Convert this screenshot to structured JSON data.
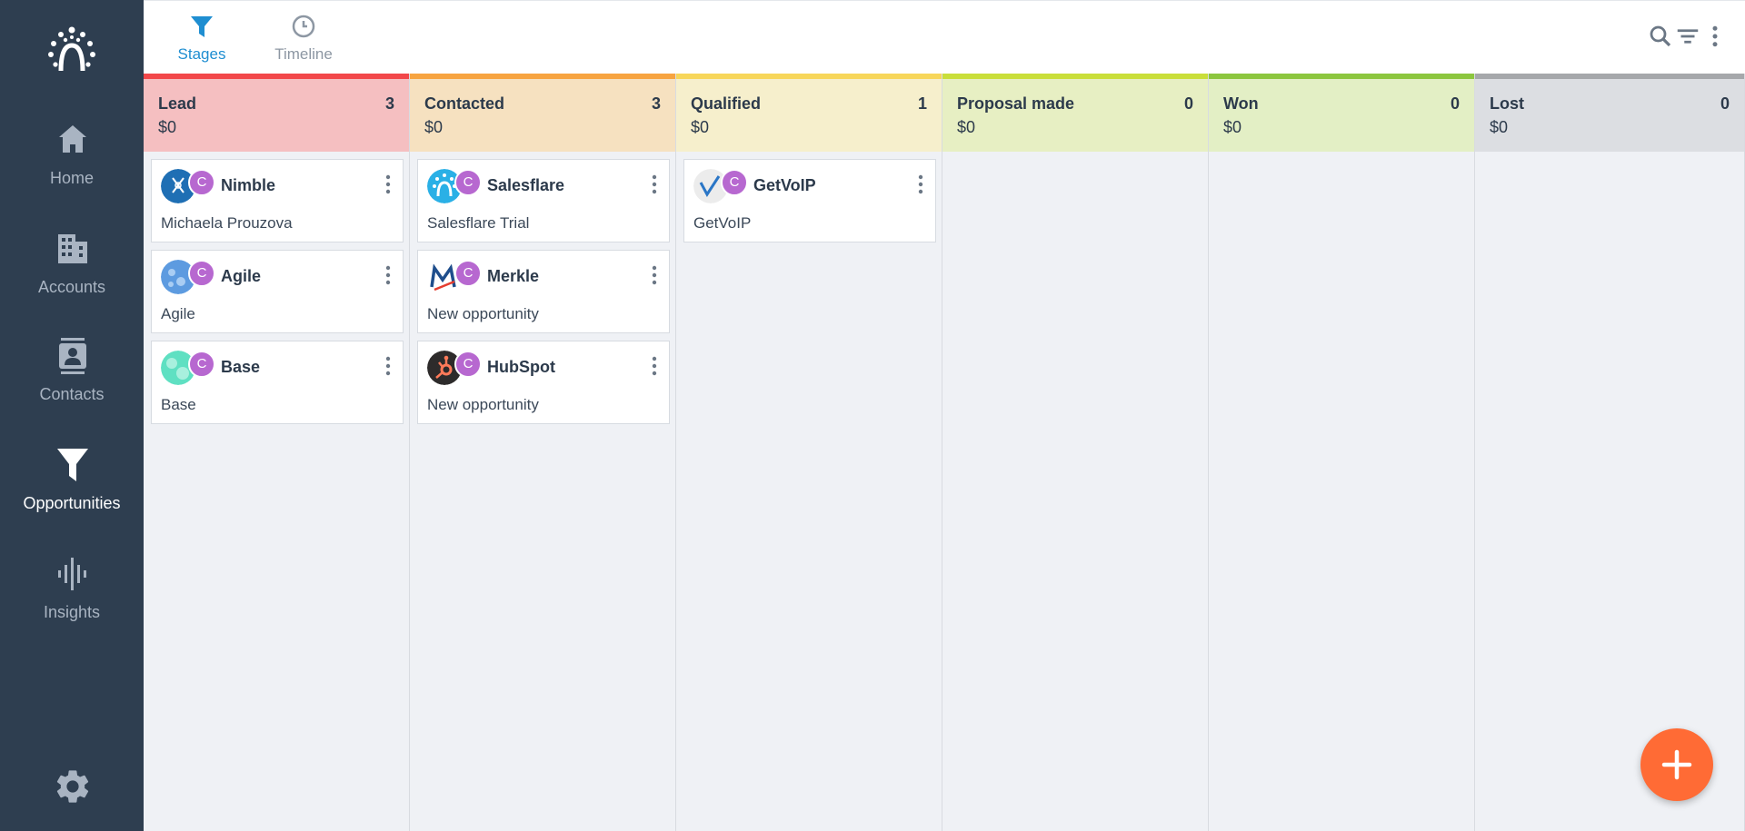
{
  "sidebar": {
    "items": [
      {
        "label": "Home",
        "icon": "home-icon"
      },
      {
        "label": "Accounts",
        "icon": "building-icon"
      },
      {
        "label": "Contacts",
        "icon": "contact-card-icon"
      },
      {
        "label": "Opportunities",
        "icon": "funnel-icon",
        "active": true
      },
      {
        "label": "Insights",
        "icon": "bars-icon"
      }
    ],
    "settings_icon": "gear-icon",
    "logo_icon": "salesflare-logo-icon"
  },
  "header": {
    "tabs": [
      {
        "label": "Stages",
        "icon": "funnel-icon",
        "active": true
      },
      {
        "label": "Timeline",
        "icon": "clock-icon"
      }
    ],
    "tools": [
      "search-icon",
      "filter-icon",
      "more-vertical-icon"
    ]
  },
  "stages": [
    {
      "name": "Lead",
      "count": "3",
      "amount": "$0",
      "color": "#f2474a",
      "bg": "#f5bfc1",
      "cards": [
        {
          "name": "Nimble",
          "subtitle": "Michaela Prouzova",
          "badge": "C",
          "logo": "nimble"
        },
        {
          "name": "Agile",
          "subtitle": "Agile",
          "badge": "C",
          "logo": "agile"
        },
        {
          "name": "Base",
          "subtitle": "Base",
          "badge": "C",
          "logo": "base"
        }
      ]
    },
    {
      "name": "Contacted",
      "count": "3",
      "amount": "$0",
      "color": "#f7a440",
      "bg": "#f6e1c0",
      "cards": [
        {
          "name": "Salesflare",
          "subtitle": "Salesflare Trial",
          "badge": "C",
          "logo": "salesflare"
        },
        {
          "name": "Merkle",
          "subtitle": "New opportunity",
          "badge": "C",
          "logo": "merkle"
        },
        {
          "name": "HubSpot",
          "subtitle": "New opportunity",
          "badge": "C",
          "logo": "hubspot"
        }
      ]
    },
    {
      "name": "Qualified",
      "count": "1",
      "amount": "$0",
      "color": "#f7d65a",
      "bg": "#f6efcc",
      "cards": [
        {
          "name": "GetVoIP",
          "subtitle": "GetVoIP",
          "badge": "C",
          "logo": "getvoip"
        }
      ]
    },
    {
      "name": "Proposal made",
      "count": "0",
      "amount": "$0",
      "color": "#c9de3a",
      "bg": "#e7efc3",
      "cards": []
    },
    {
      "name": "Won",
      "count": "0",
      "amount": "$0",
      "color": "#8cc63e",
      "bg": "#e3efc5",
      "cards": []
    },
    {
      "name": "Lost",
      "count": "0",
      "amount": "$0",
      "color": "#a6a8ab",
      "bg": "#dcdee2",
      "cards": []
    }
  ],
  "fab": {
    "icon": "plus-icon",
    "color": "#ff6b35"
  }
}
